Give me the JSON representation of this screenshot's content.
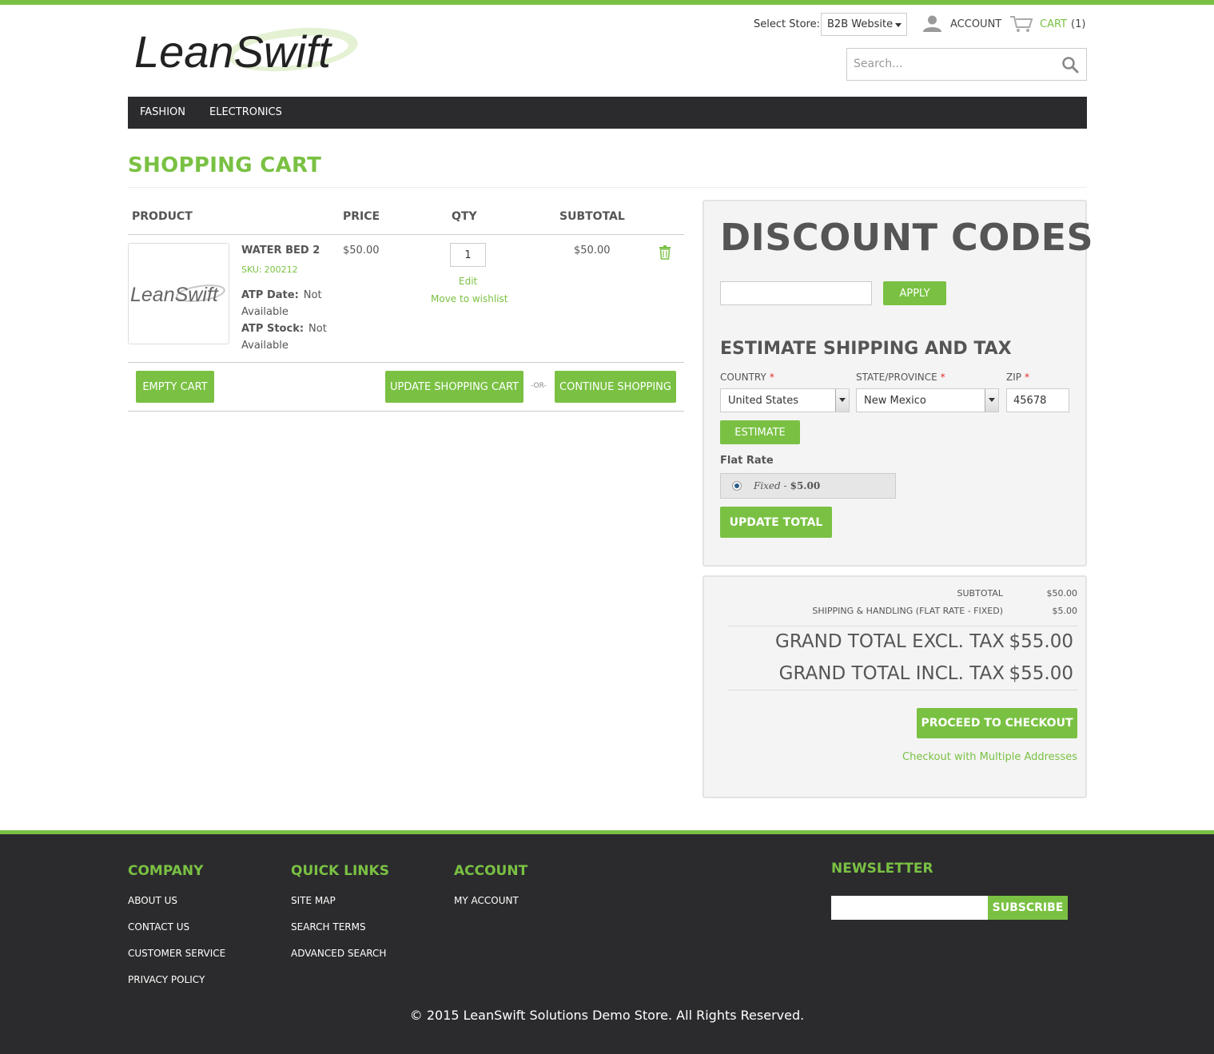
{
  "header": {
    "logo_text": "LeanSwift",
    "store_label": "Select Store:",
    "store_value": "B2B Website",
    "account_label": "ACCOUNT",
    "cart_label": "CART",
    "cart_count": "(1)",
    "search_placeholder": "Search..."
  },
  "nav": {
    "items": [
      {
        "label": "FASHION"
      },
      {
        "label": "ELECTRONICS"
      }
    ]
  },
  "page": {
    "title": "SHOPPING CART"
  },
  "cart": {
    "headers": {
      "product": "PRODUCT",
      "price": "PRICE",
      "qty": "QTY",
      "subtotal": "SUBTOTAL"
    },
    "items": [
      {
        "image_logo_text": "LeanSwift",
        "name": "WATER BED 2",
        "sku_label": "SKU:",
        "sku": "200212",
        "atp_date_label": "ATP Date:",
        "atp_date_value": "Not Available",
        "atp_stock_label": "ATP Stock:",
        "atp_stock_value": "Not Available",
        "price": "$50.00",
        "qty": "1",
        "edit_label": "Edit",
        "wishlist_label": "Move to wishlist",
        "subtotal": "$50.00"
      }
    ],
    "empty_label": "EMPTY CART",
    "update_label": "UPDATE SHOPPING CART",
    "or_label": "-OR-",
    "continue_label": "CONTINUE SHOPPING"
  },
  "discount": {
    "title": "DISCOUNT CODES",
    "code_value": "",
    "apply_label": "APPLY"
  },
  "shipping": {
    "title": "ESTIMATE SHIPPING AND TAX",
    "country_label": "COUNTRY",
    "country_value": "United States",
    "state_label": "STATE/PROVINCE",
    "state_value": "New Mexico",
    "zip_label": "ZIP",
    "zip_value": "45678",
    "required_mark": "*",
    "estimate_label": "ESTIMATE",
    "method_title": "Flat Rate",
    "rate_name": "Fixed",
    "rate_sep": "-",
    "rate_price": "$5.00",
    "update_total_label": "UPDATE TOTAL"
  },
  "totals": {
    "subtotal_label": "SUBTOTAL",
    "subtotal_value": "$50.00",
    "shipping_label": "SHIPPING & HANDLING (FLAT RATE - FIXED)",
    "shipping_value": "$5.00",
    "grand_excl_label": "GRAND TOTAL EXCL. TAX",
    "grand_excl_value": "$55.00",
    "grand_incl_label": "GRAND TOTAL INCL. TAX",
    "grand_incl_value": "$55.00",
    "checkout_label": "PROCEED TO CHECKOUT",
    "multi_label": "Checkout with Multiple Addresses"
  },
  "footer": {
    "company": {
      "title": "COMPANY",
      "links": [
        "ABOUT US",
        "CONTACT US",
        "CUSTOMER SERVICE",
        "PRIVACY POLICY"
      ]
    },
    "quick_links": {
      "title": "QUICK LINKS",
      "links": [
        "SITE MAP",
        "SEARCH TERMS",
        "ADVANCED SEARCH"
      ]
    },
    "account": {
      "title": "ACCOUNT",
      "links": [
        "MY ACCOUNT"
      ]
    },
    "newsletter": {
      "title": "NEWSLETTER",
      "subscribe_label": "SUBSCRIBE"
    },
    "copyright": "© 2015 LeanSwift Solutions Demo Store. All Rights Reserved."
  },
  "colors": {
    "accent": "#7ac143",
    "nav_bg": "#2b2b2d",
    "panel_bg": "#f4f4f4",
    "required": "#e02b27"
  }
}
